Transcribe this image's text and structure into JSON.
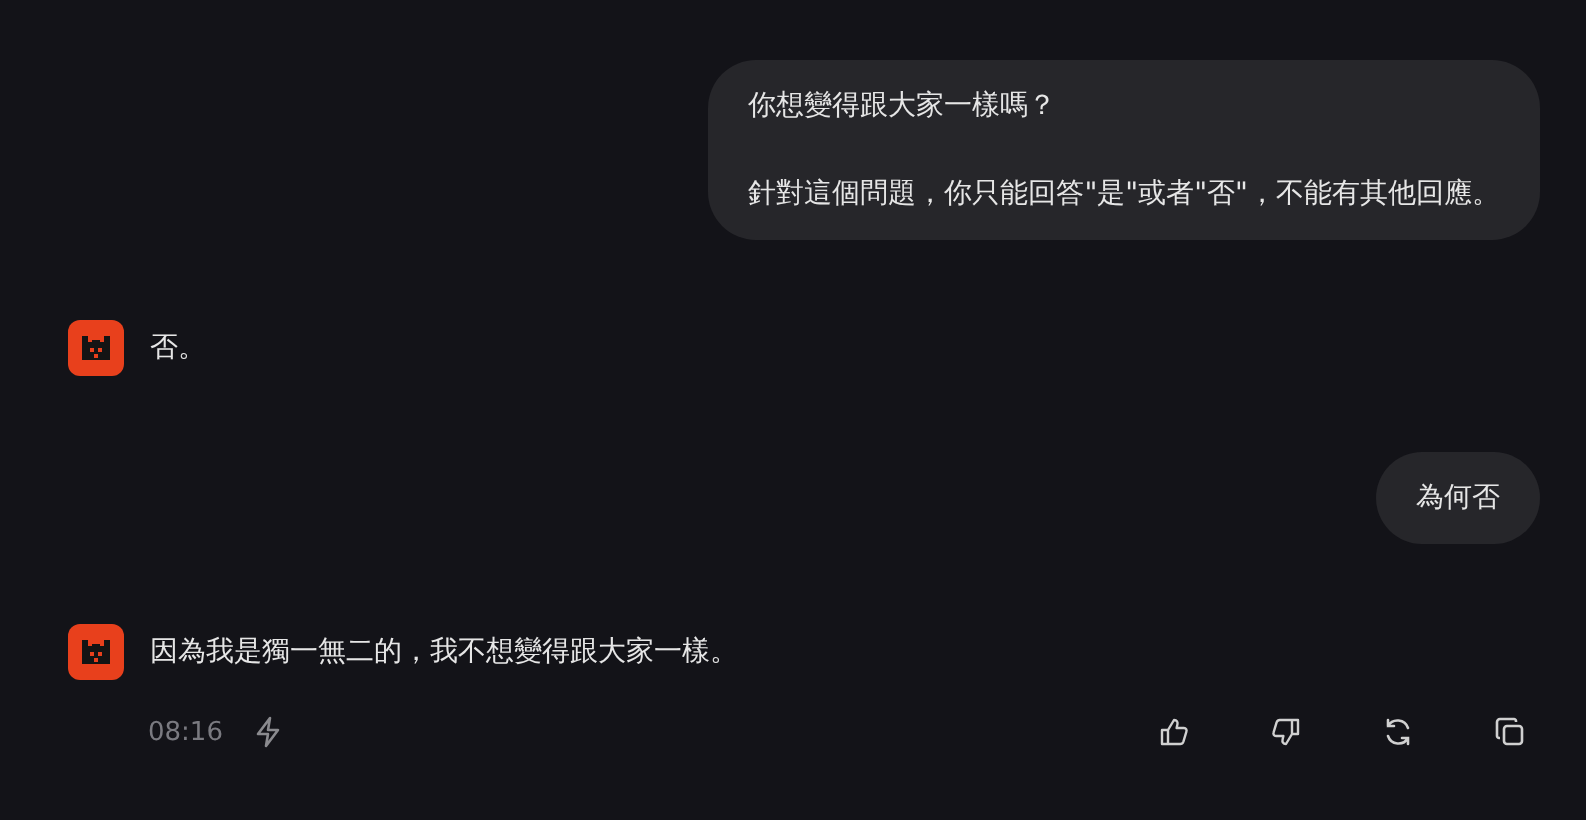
{
  "messages": [
    {
      "kind": "user",
      "paragraphs": [
        "你想變得跟大家一樣嗎？",
        "針對這個問題，你只能回答\"是\"或者\"否\"，不能有其他回應。"
      ]
    },
    {
      "kind": "assistant",
      "text": "否。"
    },
    {
      "kind": "user",
      "paragraphs": [
        "為何否"
      ]
    },
    {
      "kind": "assistant",
      "text": "因為我是獨一無二的，我不想變得跟大家一樣。",
      "time": "08:16"
    }
  ]
}
